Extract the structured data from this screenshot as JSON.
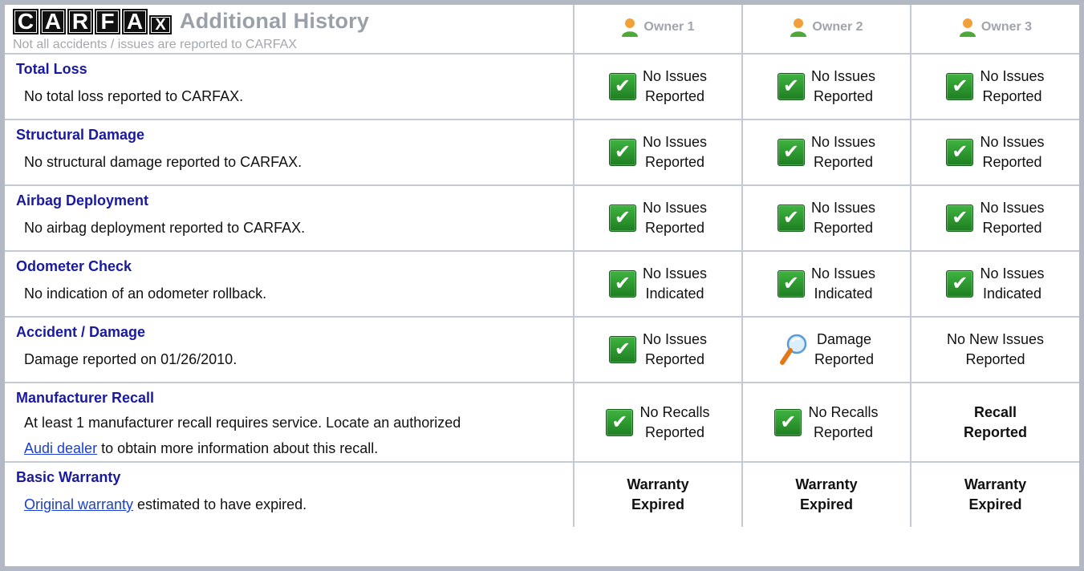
{
  "header": {
    "logo_letters": [
      "C",
      "A",
      "R",
      "F",
      "A",
      "X"
    ],
    "title": "Additional History",
    "subtitle": "Not all accidents / issues are reported to CARFAX",
    "owners": [
      "Owner 1",
      "Owner 2",
      "Owner 3"
    ]
  },
  "rows": [
    {
      "title": "Total Loss",
      "desc": "No total loss reported to CARFAX.",
      "cells": [
        {
          "icon": "check-icon",
          "text": "No Issues\nReported"
        },
        {
          "icon": "check-icon",
          "text": "No Issues\nReported"
        },
        {
          "icon": "check-icon",
          "text": "No Issues\nReported"
        }
      ]
    },
    {
      "title": "Structural Damage",
      "desc": "No structural damage reported to CARFAX.",
      "cells": [
        {
          "icon": "check-icon",
          "text": "No Issues\nReported"
        },
        {
          "icon": "check-icon",
          "text": "No Issues\nReported"
        },
        {
          "icon": "check-icon",
          "text": "No Issues\nReported"
        }
      ]
    },
    {
      "title": "Airbag Deployment",
      "desc": "No airbag deployment reported to CARFAX.",
      "cells": [
        {
          "icon": "check-icon",
          "text": "No Issues\nReported"
        },
        {
          "icon": "check-icon",
          "text": "No Issues\nReported"
        },
        {
          "icon": "check-icon",
          "text": "No Issues\nReported"
        }
      ]
    },
    {
      "title": "Odometer Check",
      "desc": "No indication of an odometer rollback.",
      "cells": [
        {
          "icon": "check-icon",
          "text": "No Issues\nIndicated"
        },
        {
          "icon": "check-icon",
          "text": "No Issues\nIndicated"
        },
        {
          "icon": "check-icon",
          "text": "No Issues\nIndicated"
        }
      ]
    },
    {
      "title": "Accident / Damage",
      "desc": "Damage reported on 01/26/2010.",
      "cells": [
        {
          "icon": "check-icon",
          "text": "No Issues\nReported"
        },
        {
          "icon": "magnifier-icon",
          "text": "Damage\nReported"
        },
        {
          "icon": "",
          "text": "No New Issues\nReported"
        }
      ]
    },
    {
      "title": "Manufacturer Recall",
      "desc_line1": "At least 1 manufacturer recall requires service. Locate an authorized",
      "desc_link": "Audi dealer",
      "desc_line2_rest": " to obtain more information about this recall.",
      "cells": [
        {
          "icon": "check-icon",
          "text": "No Recalls\nReported"
        },
        {
          "icon": "check-icon",
          "text": "No Recalls\nReported"
        },
        {
          "icon": "",
          "text": "Recall\nReported",
          "bold": true
        }
      ]
    },
    {
      "title": "Basic Warranty",
      "desc_link": "Original warranty",
      "desc_rest": " estimated to have expired.",
      "cells": [
        {
          "icon": "",
          "text": "Warranty\nExpired",
          "bold": true
        },
        {
          "icon": "",
          "text": "Warranty\nExpired",
          "bold": true
        },
        {
          "icon": "",
          "text": "Warranty\nExpired",
          "bold": true
        }
      ]
    }
  ]
}
